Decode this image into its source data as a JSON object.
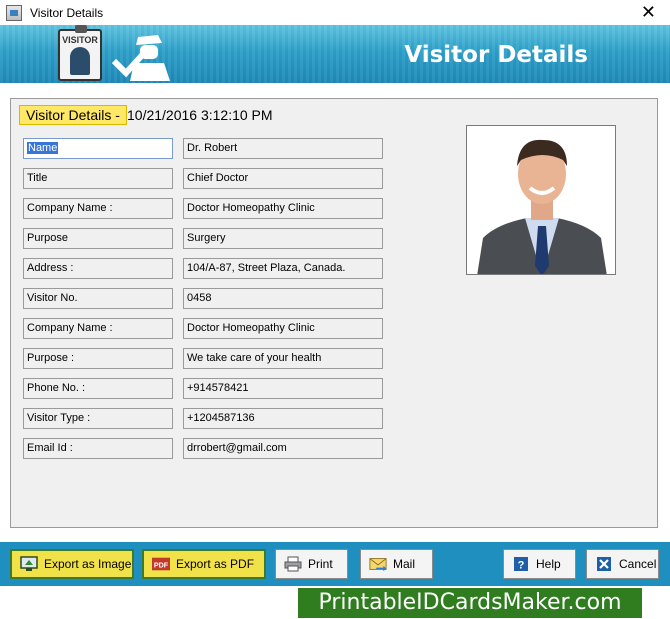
{
  "window": {
    "title": "Visitor Details",
    "close_glyph": "✕"
  },
  "banner": {
    "title": "Visitor Details",
    "badge_text": "VISITOR"
  },
  "header": {
    "label": "Visitor Details -",
    "datetime": "10/21/2016 3:12:10 PM"
  },
  "fields": [
    {
      "label": "Name",
      "value": "Dr. Robert"
    },
    {
      "label": "Title",
      "value": "Chief Doctor"
    },
    {
      "label": "Company Name :",
      "value": "Doctor Homeopathy Clinic"
    },
    {
      "label": "Purpose",
      "value": "Surgery"
    },
    {
      "label": "Address :",
      "value": "104/A-87, Street Plaza, Canada."
    },
    {
      "label": "Visitor No.",
      "value": "0458"
    },
    {
      "label": "Company Name :",
      "value": "Doctor Homeopathy Clinic"
    },
    {
      "label": "Purpose :",
      "value": "We take care of your health"
    },
    {
      "label": "Phone No. :",
      "value": "+914578421"
    },
    {
      "label": "Visitor Type :",
      "value": "+1204587136"
    },
    {
      "label": "Email Id :",
      "value": "drrobert@gmail.com"
    }
  ],
  "buttons": {
    "export_image": "Export as Image",
    "export_pdf": "Export as PDF",
    "pdf_icon_text": "PDF",
    "print": "Print",
    "mail": "Mail",
    "help": "Help",
    "cancel": "Cancel"
  },
  "icons": {
    "app": "app-icon",
    "export_image": "monitor-export-icon",
    "export_pdf": "pdf-icon",
    "print": "printer-icon",
    "mail": "envelope-icon",
    "help": "help-icon",
    "cancel": "cancel-icon"
  },
  "brand": {
    "text": "PrintableIDCardsMaker.com"
  },
  "colors": {
    "banner": "#1d88b7",
    "button_bar": "#1e8fbf",
    "header_highlight": "#ffe866",
    "export_buttons": "#f2e24a",
    "brand_bg": "#2f7d1f"
  }
}
